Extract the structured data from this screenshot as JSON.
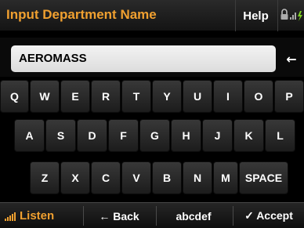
{
  "header": {
    "title": "Input Department Name",
    "help_label": "Help"
  },
  "input": {
    "value": "AEROMASS",
    "backspace_glyph": "←"
  },
  "keyboard": {
    "row1": [
      "Q",
      "W",
      "E",
      "R",
      "T",
      "Y",
      "U",
      "I",
      "O",
      "P"
    ],
    "row2": [
      "A",
      "S",
      "D",
      "F",
      "G",
      "H",
      "J",
      "K",
      "L"
    ],
    "row3": [
      "Z",
      "X",
      "C",
      "V",
      "B",
      "N",
      "M",
      "SPACE"
    ]
  },
  "footer": {
    "listen_label": "Listen",
    "back_label": "← Back",
    "mode_label": "abcdef",
    "accept_label": "✓ Accept"
  },
  "colors": {
    "accent": "#f0a030",
    "key_face": "#2a2a2a",
    "battery": "#7ed321"
  },
  "icons": {
    "status": [
      "lock-icon",
      "signal-icon",
      "battery-icon"
    ],
    "listen": "signal-bars-icon"
  }
}
